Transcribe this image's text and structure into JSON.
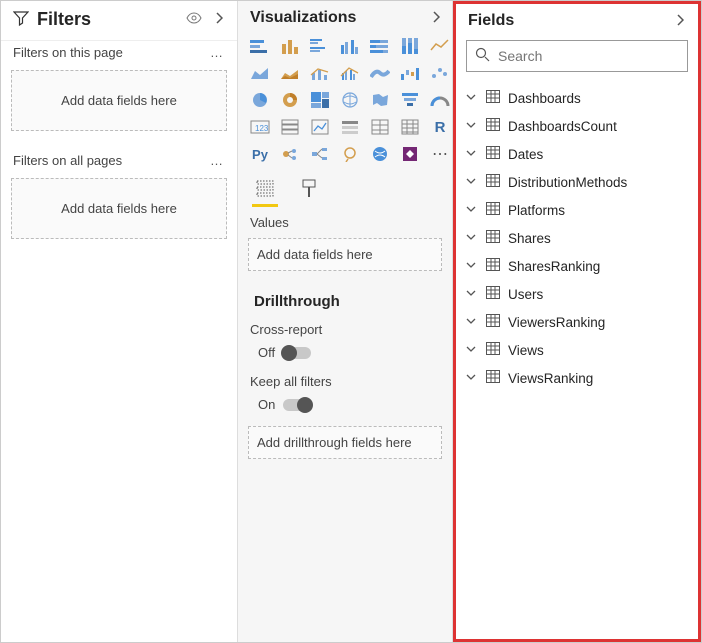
{
  "filters": {
    "title": "Filters",
    "section_page": "Filters on this page",
    "section_all": "Filters on all pages",
    "dropzone_text": "Add data fields here"
  },
  "viz": {
    "title": "Visualizations",
    "values_label": "Values",
    "values_dropzone": "Add data fields here",
    "drill_title": "Drillthrough",
    "cross_report_label": "Cross-report",
    "cross_report_state": "Off",
    "keep_filters_label": "Keep all filters",
    "keep_filters_state": "On",
    "drill_dropzone": "Add drillthrough fields here"
  },
  "fields": {
    "title": "Fields",
    "search_placeholder": "Search",
    "tables": [
      "Dashboards",
      "DashboardsCount",
      "Dates",
      "DistributionMethods",
      "Platforms",
      "Shares",
      "SharesRanking",
      "Users",
      "ViewersRanking",
      "Views",
      "ViewsRanking"
    ]
  }
}
